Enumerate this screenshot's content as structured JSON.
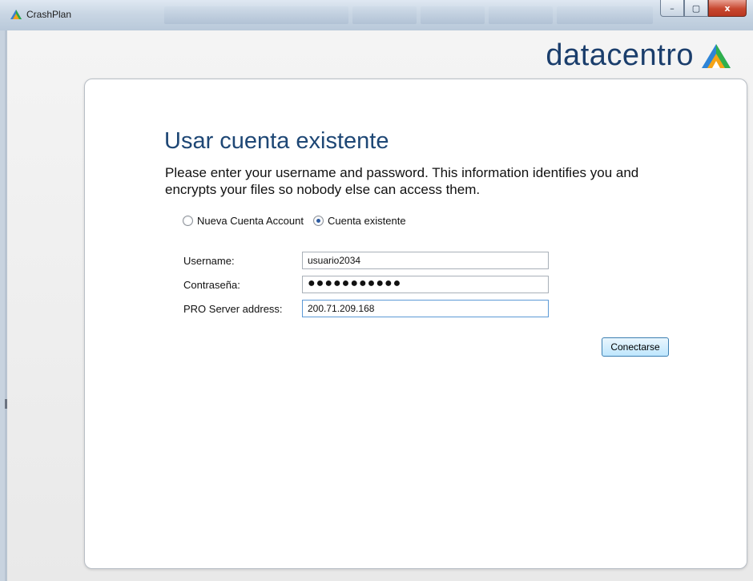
{
  "window": {
    "title": "CrashPlan",
    "controls": {
      "minimize": "–",
      "maximize": "▢",
      "close": "x"
    }
  },
  "brand": {
    "name": "datacentro"
  },
  "login": {
    "heading": "Usar cuenta existente",
    "instructions": "Please enter your username and password. This information identifies you and encrypts your files so nobody else can access them.",
    "account_options": [
      {
        "label": "Nueva Cuenta Account",
        "selected": false
      },
      {
        "label": "Cuenta existente",
        "selected": true
      }
    ],
    "fields": {
      "username": {
        "label": "Username:",
        "value": "usuario2034"
      },
      "password": {
        "label": "Contraseña:",
        "value": "●●●●●●●●●●●"
      },
      "server": {
        "label": "PRO Server address:",
        "value": "200.71.209.168"
      }
    },
    "connect_button": "Conectarse"
  }
}
